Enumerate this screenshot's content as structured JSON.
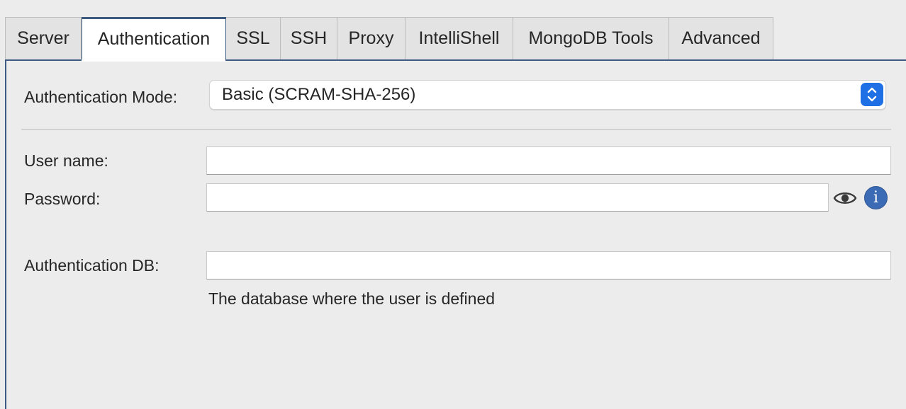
{
  "tabs": [
    {
      "label": "Server"
    },
    {
      "label": "Authentication",
      "active": true
    },
    {
      "label": "SSL"
    },
    {
      "label": "SSH"
    },
    {
      "label": "Proxy"
    },
    {
      "label": "IntelliShell"
    },
    {
      "label": "MongoDB Tools"
    },
    {
      "label": "Advanced"
    }
  ],
  "auth_mode": {
    "label": "Authentication Mode:",
    "value": "Basic (SCRAM-SHA-256)"
  },
  "username": {
    "label": "User name:",
    "value": ""
  },
  "password": {
    "label": "Password:",
    "value": ""
  },
  "auth_db": {
    "label": "Authentication DB:",
    "value": "",
    "hint": "The database where the user is defined"
  },
  "icons": {
    "show_password": "eye-icon",
    "info": "info-icon",
    "stepper": "chevron-updown-icon"
  },
  "colors": {
    "accent": "#3d5a80",
    "stepper": "#1f6fe5",
    "info": "#3c6bb5",
    "background": "#ececec"
  }
}
